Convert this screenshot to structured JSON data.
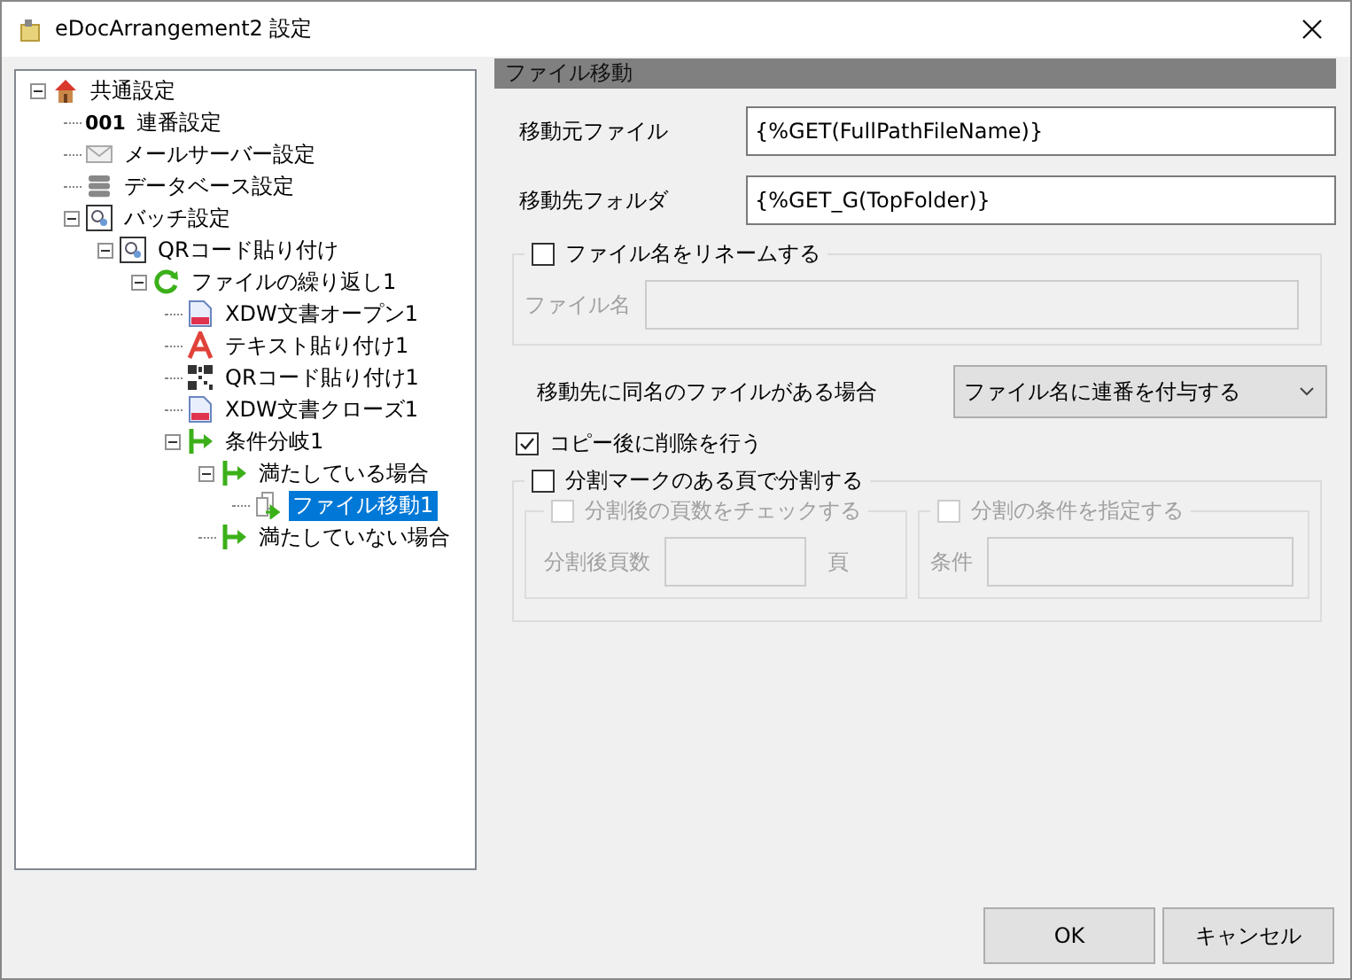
{
  "window": {
    "title": "eDocArrangement2 設定"
  },
  "tree": [
    {
      "label": "共通設定",
      "kind": "house",
      "expanded": true,
      "selected": false,
      "children": [
        {
          "label": "連番設定",
          "kind": "counter",
          "prefix": "001",
          "selected": false
        },
        {
          "label": "メールサーバー設定",
          "kind": "mail",
          "selected": false
        },
        {
          "label": "データベース設定",
          "kind": "database",
          "selected": false
        },
        {
          "label": "バッチ設定",
          "kind": "batch",
          "expanded": true,
          "selected": false,
          "children": [
            {
              "label": "QRコード貼り付け",
              "kind": "batch",
              "expanded": true,
              "selected": false,
              "children": [
                {
                  "label": "ファイルの繰り返し1",
                  "kind": "loop",
                  "expanded": true,
                  "selected": false,
                  "children": [
                    {
                      "label": "XDW文書オープン1",
                      "kind": "xdw",
                      "selected": false
                    },
                    {
                      "label": "テキスト貼り付け1",
                      "kind": "text",
                      "selected": false
                    },
                    {
                      "label": "QRコード貼り付け1",
                      "kind": "qr",
                      "selected": false
                    },
                    {
                      "label": "XDW文書クローズ1",
                      "kind": "xdw",
                      "selected": false
                    },
                    {
                      "label": "条件分岐1",
                      "kind": "branch",
                      "expanded": true,
                      "selected": false,
                      "children": [
                        {
                          "label": "満たしている場合",
                          "kind": "branch",
                          "expanded": true,
                          "selected": false,
                          "children": [
                            {
                              "label": "ファイル移動1",
                              "kind": "move",
                              "selected": true
                            }
                          ]
                        },
                        {
                          "label": "満たしていない場合",
                          "kind": "branch",
                          "selected": false
                        }
                      ]
                    }
                  ]
                }
              ]
            }
          ]
        }
      ]
    }
  ],
  "panel": {
    "title": "ファイル移動",
    "source": {
      "label": "移動元ファイル",
      "value": "{%GET(FullPathFileName)}"
    },
    "dest": {
      "label": "移動先フォルダ",
      "value": "{%GET_G(TopFolder)}"
    },
    "rename": {
      "label": "ファイル名をリネームする",
      "checked": false,
      "field_label": "ファイル名"
    },
    "conflict": {
      "label": "移動先に同名のファイルがある場合",
      "value": "ファイル名に連番を付与する"
    },
    "delete_after": {
      "label": "コピー後に削除を行う",
      "checked": true
    },
    "split": {
      "label": "分割マークのある頁で分割する",
      "checked": false,
      "page_check": {
        "label": "分割後の頁数をチェックする",
        "checked": false,
        "field_label": "分割後頁数",
        "unit": "頁"
      },
      "condition": {
        "label": "分割の条件を指定する",
        "checked": false,
        "field_label": "条件"
      }
    }
  },
  "buttons": [
    {
      "label": "OK"
    },
    {
      "label": "キャンセル"
    }
  ]
}
